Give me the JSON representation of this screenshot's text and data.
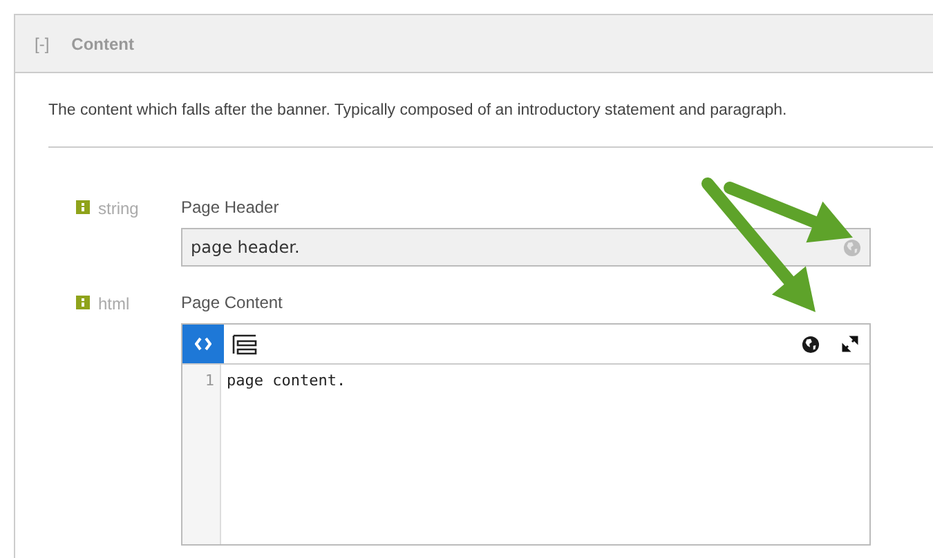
{
  "section": {
    "toggle": "[-]",
    "title": "Content"
  },
  "description": "The content which falls after the banner. Typically composed of an introductory statement and paragraph.",
  "fields": [
    {
      "kind": "string",
      "type_label": "string",
      "label": "Page Header",
      "value": "page header."
    },
    {
      "kind": "html",
      "type_label": "html",
      "label": "Page Content",
      "modes": [
        {
          "selected": true
        },
        {
          "selected": false
        }
      ],
      "lines": [
        {
          "number": "1",
          "text": "page content."
        }
      ]
    }
  ]
}
